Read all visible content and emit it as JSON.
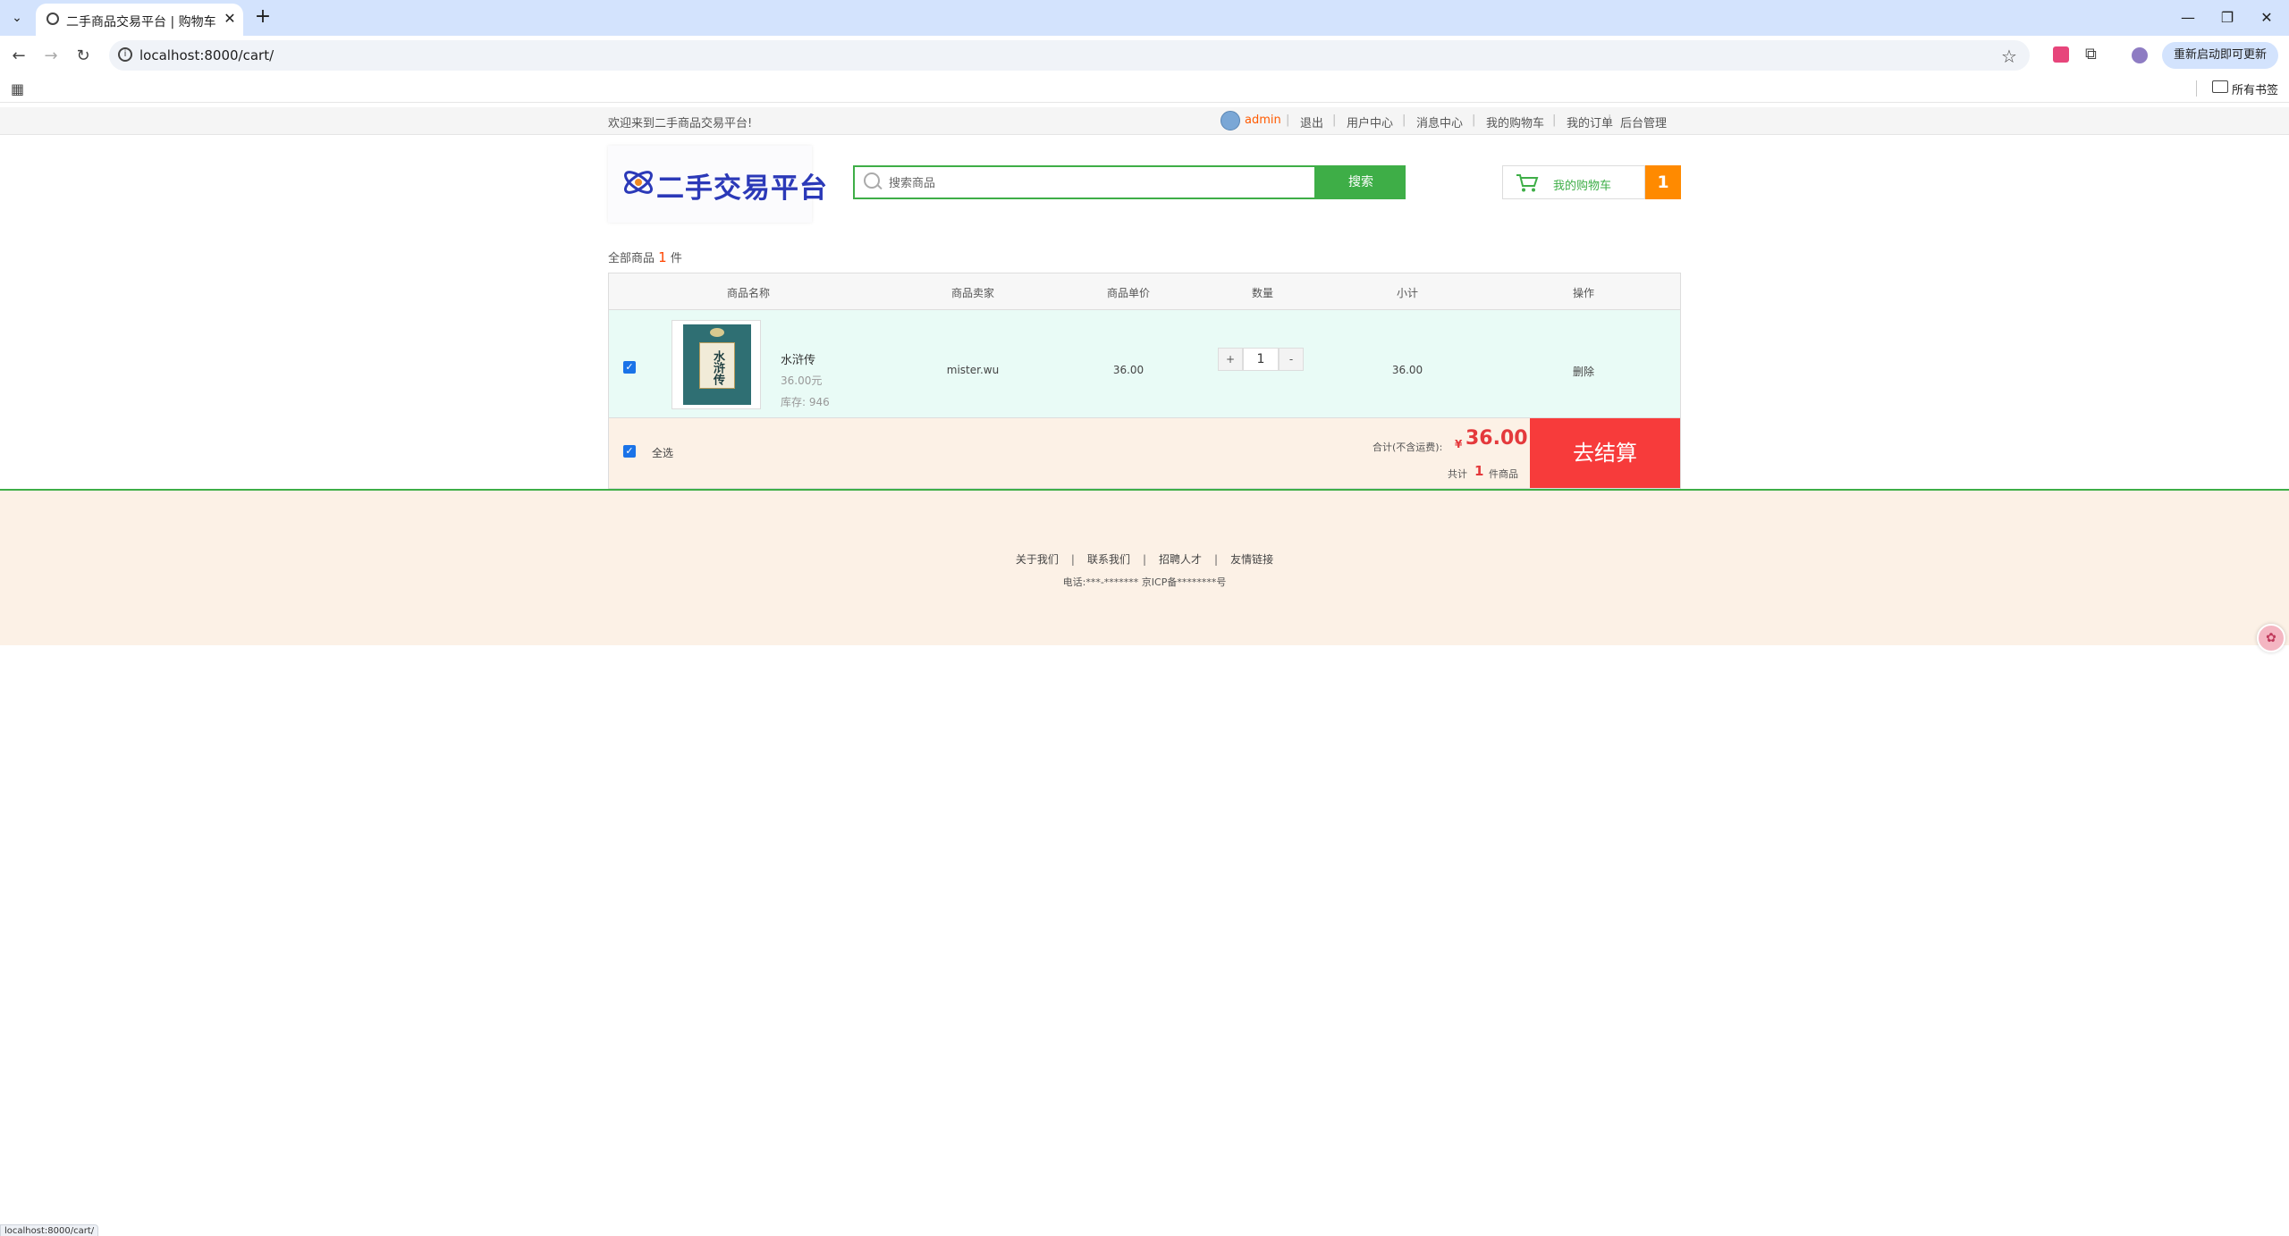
{
  "browser": {
    "tab_title": "二手商品交易平台 | 购物车",
    "url": "localhost:8000/cart/",
    "update_button": "重新启动即可更新",
    "all_bookmarks": "所有书签",
    "status_url": "localhost:8000/cart/"
  },
  "topbar": {
    "welcome": "欢迎来到二手商品交易平台!",
    "username": "admin",
    "links": [
      "退出",
      "用户中心",
      "消息中心",
      "我的购物车",
      "我的订单",
      "后台管理"
    ],
    "username_color": "#ff5a00"
  },
  "header": {
    "logo_text": "二手交易平台",
    "search_placeholder": "搜索商品",
    "search_button": "搜索",
    "cart_label": "我的购物车",
    "cart_count": "1",
    "accent_color": "#3eae47"
  },
  "cart": {
    "summary_prefix": "全部商品",
    "summary_count": "1",
    "summary_suffix": "件",
    "columns": [
      "商品名称",
      "商品卖家",
      "商品单价",
      "数量",
      "小计",
      "操作"
    ],
    "items": [
      {
        "checked": true,
        "name": "水浒传",
        "price_text": "36.00元",
        "stock_label": "库存:",
        "stock": "946",
        "seller": "mister.wu",
        "unit_price": "36.00",
        "quantity": "1",
        "plus": "+",
        "minus": "-",
        "subtotal": "36.00",
        "action": "删除",
        "cover_title": "水浒传"
      }
    ],
    "select_all": "全选",
    "total_label": "合计(不含运费):",
    "currency": "¥",
    "total": "36.00",
    "count_prefix": "共计",
    "count": "1",
    "count_suffix": "件商品",
    "checkout": "去结算"
  },
  "footer": {
    "links": [
      "关于我们",
      "联系我们",
      "招聘人才",
      "友情链接"
    ],
    "info": "电话:***-******* 京ICP备********号"
  }
}
